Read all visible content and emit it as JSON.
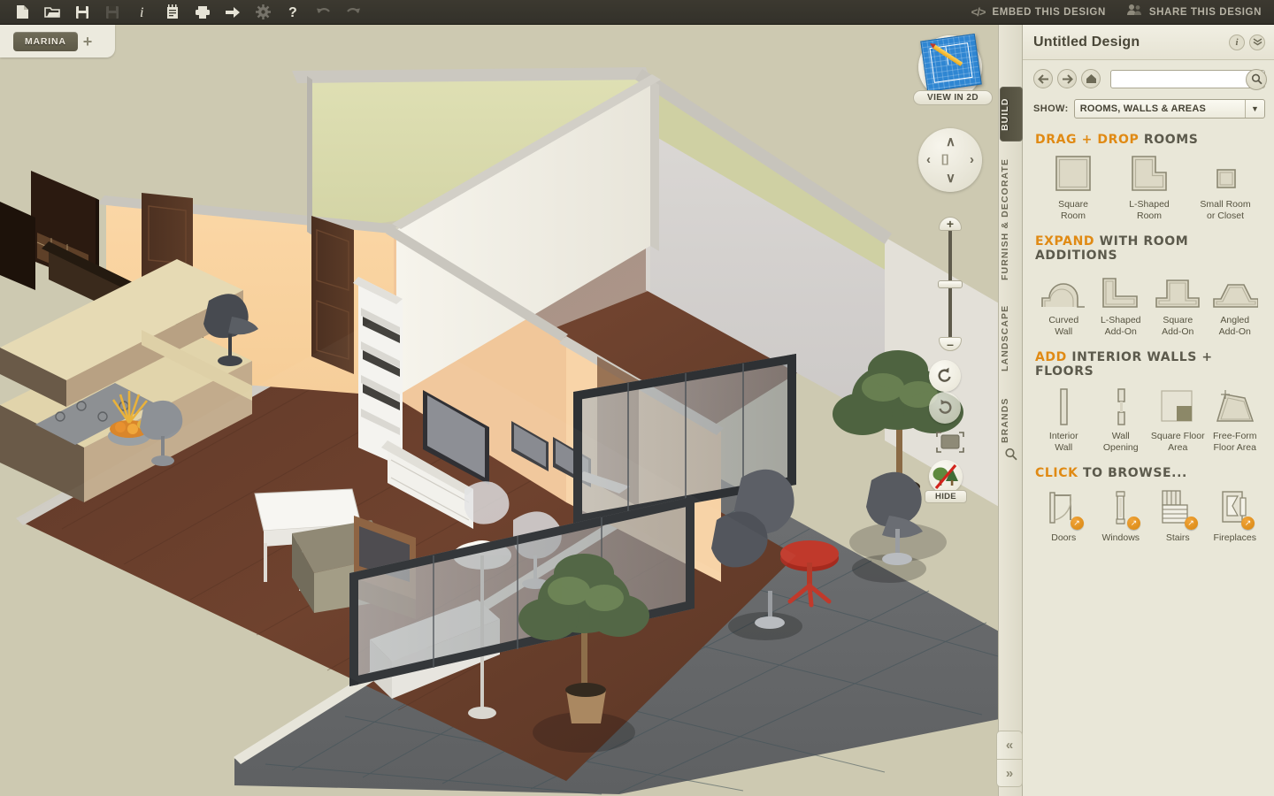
{
  "toolbar": {
    "icons": [
      {
        "name": "new-document-icon",
        "label": "New"
      },
      {
        "name": "open-folder-icon",
        "label": "Open"
      },
      {
        "name": "save-icon",
        "label": "Save"
      },
      {
        "name": "save-as-icon",
        "label": "Save As"
      },
      {
        "name": "info-icon",
        "label": "Info"
      },
      {
        "name": "notes-icon",
        "label": "Notes"
      },
      {
        "name": "print-icon",
        "label": "Print"
      },
      {
        "name": "export-icon",
        "label": "Export"
      },
      {
        "name": "settings-gear-icon",
        "label": "Settings"
      },
      {
        "name": "help-icon",
        "label": "Help"
      },
      {
        "name": "undo-icon",
        "label": "Undo"
      },
      {
        "name": "redo-icon",
        "label": "Redo"
      }
    ],
    "embed_label": "EMBED THIS DESIGN",
    "share_label": "SHARE THIS DESIGN",
    "embed_icon": "</>"
  },
  "project_tabs": {
    "active": "MARINA",
    "add_label": "+"
  },
  "view_controls": {
    "view_2d_label": "VIEW IN 2D",
    "pan_up": "∧",
    "pan_down": "∨",
    "pan_left": "‹",
    "pan_right": "›",
    "pan_center": "[ ]",
    "zoom_in": "+",
    "zoom_out": "–",
    "rotate_left_label": "Rotate Left",
    "rotate_right_label": "Rotate Right",
    "fit_label": "Fit View",
    "hide_label": "HIDE"
  },
  "rail": {
    "tabs": [
      {
        "label": "BUILD",
        "active": true
      },
      {
        "label": "FURNISH & DECORATE",
        "active": false
      },
      {
        "label": "LANDSCAPE",
        "active": false
      },
      {
        "label": "BRANDS",
        "active": false
      }
    ],
    "search_label": "Search"
  },
  "panel": {
    "title": "Untitled Design",
    "info_glyph": "i",
    "collapse_glyph": "»",
    "nav": {
      "back": "←",
      "forward": "→",
      "home": "⌂"
    },
    "search": {
      "value": "",
      "placeholder": ""
    },
    "show": {
      "label": "SHOW:",
      "value": "ROOMS, WALLS & AREAS",
      "caret": "▼"
    },
    "sections": [
      {
        "id": "drag-drop-rooms",
        "title_highlight": "DRAG + DROP",
        "title_rest": "ROOMS",
        "items": [
          {
            "name": "square-room",
            "caption": "Square\nRoom",
            "icon": "square-room-icon"
          },
          {
            "name": "l-shaped-room",
            "caption": "L-Shaped\nRoom",
            "icon": "l-shaped-room-icon"
          },
          {
            "name": "small-room-or-closet",
            "caption": "Small Room\nor Closet",
            "icon": "small-room-icon"
          }
        ]
      },
      {
        "id": "expand-room-additions",
        "title_highlight": "EXPAND",
        "title_rest": "WITH ROOM ADDITIONS",
        "items": [
          {
            "name": "curved-wall",
            "caption": "Curved\nWall",
            "icon": "curved-wall-icon"
          },
          {
            "name": "l-shaped-add-on",
            "caption": "L-Shaped\nAdd-On",
            "icon": "l-shaped-addon-icon"
          },
          {
            "name": "square-add-on",
            "caption": "Square\nAdd-On",
            "icon": "square-addon-icon"
          },
          {
            "name": "angled-add-on",
            "caption": "Angled\nAdd-On",
            "icon": "angled-addon-icon"
          }
        ]
      },
      {
        "id": "add-interior-walls-floors",
        "title_highlight": "ADD",
        "title_rest": "INTERIOR WALLS + FLOORS",
        "items": [
          {
            "name": "interior-wall",
            "caption": "Interior\nWall",
            "icon": "interior-wall-icon"
          },
          {
            "name": "wall-opening",
            "caption": "Wall\nOpening",
            "icon": "wall-opening-icon"
          },
          {
            "name": "square-floor-area",
            "caption": "Square Floor\nArea",
            "icon": "square-floor-icon"
          },
          {
            "name": "free-form-floor-area",
            "caption": "Free-Form\nFloor Area",
            "icon": "free-form-floor-icon"
          }
        ]
      },
      {
        "id": "click-to-browse",
        "title_highlight": "CLICK",
        "title_rest": "TO BROWSE...",
        "items": [
          {
            "name": "doors",
            "caption": "Doors",
            "icon": "door-icon",
            "badge": "↗"
          },
          {
            "name": "windows",
            "caption": "Windows",
            "icon": "window-icon",
            "badge": "↗"
          },
          {
            "name": "stairs",
            "caption": "Stairs",
            "icon": "stairs-icon",
            "badge": "↗"
          },
          {
            "name": "fireplaces",
            "caption": "Fireplaces",
            "icon": "fireplace-icon",
            "badge": "↗"
          }
        ]
      }
    ]
  },
  "collapse": {
    "left_glyph": "«",
    "right_glyph": "»"
  },
  "colors": {
    "accent_orange": "#e08a14",
    "toolbar_dark": "#3c3930",
    "panel_bg": "#e9e7d8",
    "canvas_bg": "#cdc9b1",
    "tab_active": "#5f5c4a"
  }
}
